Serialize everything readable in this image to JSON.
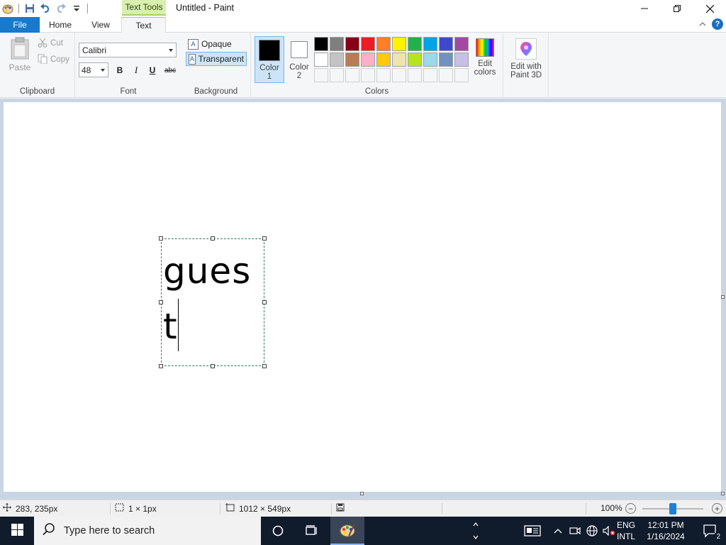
{
  "window": {
    "title": "Untitled - Paint",
    "context_tab_title": "Text Tools"
  },
  "tabs": {
    "file": "File",
    "home": "Home",
    "view": "View",
    "text": "Text"
  },
  "ribbon": {
    "clipboard": {
      "group_label": "Clipboard",
      "paste": "Paste",
      "cut": "Cut",
      "copy": "Copy"
    },
    "font": {
      "group_label": "Font",
      "family": "Calibri",
      "size": "48",
      "bold": "B",
      "italic": "I",
      "underline": "U",
      "strikethrough": "abc"
    },
    "background": {
      "group_label": "Background",
      "opaque": "Opaque",
      "transparent": "Transparent",
      "selected": "transparent"
    },
    "colors": {
      "group_label": "Colors",
      "color1_label_line1": "Color",
      "color1_label_line2": "1",
      "color2_label_line1": "Color",
      "color2_label_line2": "2",
      "color1": "#000000",
      "color2": "#ffffff",
      "palette_row1": [
        "#000000",
        "#7f7f7f",
        "#880015",
        "#ed1c24",
        "#ff7f27",
        "#fff200",
        "#22b14c",
        "#00a2e8",
        "#3f48cc",
        "#a349a4"
      ],
      "palette_row2": [
        "#ffffff",
        "#c3c3c3",
        "#b97a57",
        "#ffaec9",
        "#ffc90e",
        "#efe4b0",
        "#b5e61d",
        "#99d9ea",
        "#7092be",
        "#c8bfe7"
      ],
      "edit_colors_line1": "Edit",
      "edit_colors_line2": "colors",
      "paint3d_line1": "Edit with",
      "paint3d_line2": "Paint 3D"
    }
  },
  "canvas": {
    "typed_text": "guest"
  },
  "status": {
    "cursor_pos": "283, 235px",
    "selection_size": "1 × 1px",
    "image_size": "1012 × 549px",
    "zoom": "100%",
    "zoom_level": 0.5
  },
  "taskbar": {
    "search_placeholder": "Type here to search",
    "lang_line1": "ENG",
    "lang_line2": "INTL",
    "time": "12:01 PM",
    "date": "1/16/2024",
    "notification_count": "2"
  }
}
